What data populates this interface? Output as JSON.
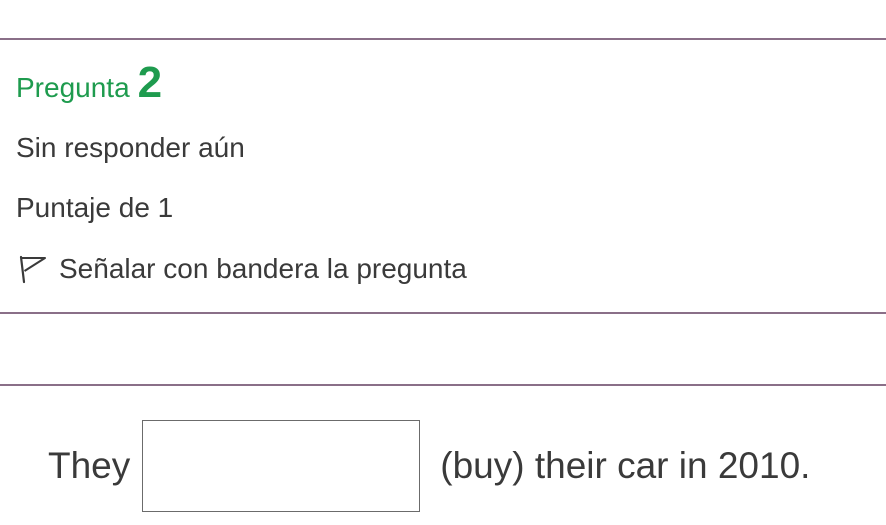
{
  "question": {
    "label": "Pregunta",
    "number": "2",
    "status": "Sin responder aún",
    "score": "Puntaje de 1",
    "flag_label": "Señalar con bandera la pregunta",
    "flag_icon": "flag-outline-icon"
  },
  "content": {
    "before_blank": "They",
    "answer_value": "",
    "after_blank": "(buy) their car in 2010."
  },
  "colors": {
    "accent": "#1e9b4e",
    "divider": "#8a6f88",
    "text": "#3a3a3a"
  }
}
